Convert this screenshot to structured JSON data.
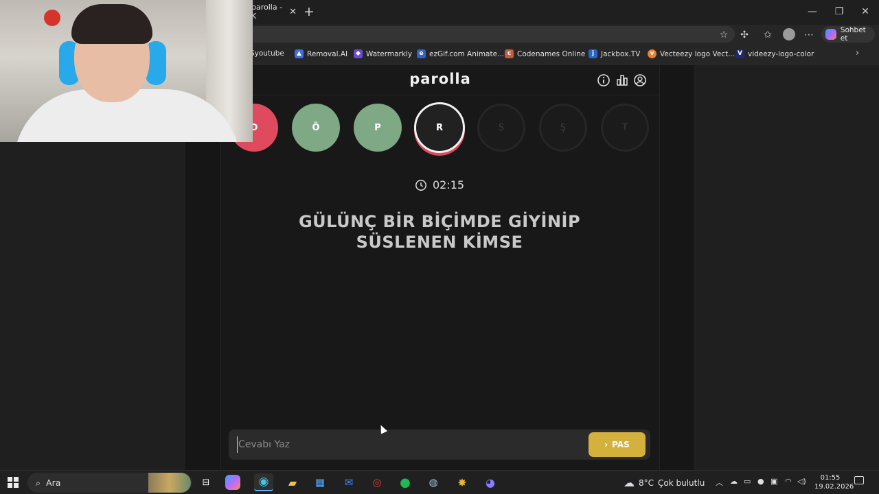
{
  "browser": {
    "tab_title": "parolla - K",
    "tab_close": "✕",
    "new_tab": "+",
    "window_controls": {
      "minimize": "—",
      "restore": "❐",
      "close": "✕"
    },
    "copilot_label": "Sohbet et",
    "bookmarks": [
      {
        "label": "Syoutube",
        "icon": "youtube-icon",
        "color": "#d12a2a"
      },
      {
        "label": "Removal.AI",
        "icon": "removal-ai-icon",
        "color": "#3d6fe0"
      },
      {
        "label": "Watermarkly",
        "icon": "shield-icon",
        "color": "#6a4bd6"
      },
      {
        "label": "ezGif.com Animate...",
        "icon": "ezgif-icon",
        "color": "#2f63c9"
      },
      {
        "label": "Codenames Online",
        "icon": "codenames-icon",
        "color": "#c45b3b"
      },
      {
        "label": "Jackbox.TV",
        "icon": "jackbox-icon",
        "color": "#2465c9"
      },
      {
        "label": "Vecteezy logo Vect...",
        "icon": "vecteezy-icon",
        "color": "#e9812f"
      },
      {
        "label": "videezy-logo-color",
        "icon": "videezy-icon",
        "color": "#1f2a6e"
      }
    ]
  },
  "game": {
    "logo": "parolla",
    "letters": [
      {
        "char": "Ö",
        "state": "correct"
      },
      {
        "char": "P",
        "state": "correct"
      },
      {
        "char": "R",
        "state": "active"
      },
      {
        "char": "S",
        "state": "pending"
      },
      {
        "char": "Ş",
        "state": "pending"
      },
      {
        "char": "T",
        "state": "pending"
      }
    ],
    "partial_letter": "D",
    "timer": "02:15",
    "question_line1": "GÜLÜNÇ BİR BİÇİMDE GİYİNİP",
    "question_line2": "SÜSLENEN KİMSE",
    "answer_placeholder": "Cevabı Yaz",
    "pass_label": "PAS",
    "colors": {
      "red": "#e04a5e",
      "green": "#7fa884",
      "pass": "#d4b03c"
    }
  },
  "taskbar": {
    "search_label": "Ara",
    "weather_temp": "8°C",
    "weather_text": "Çok bulutlu",
    "time": "01:55",
    "date": "19.02.2026"
  }
}
